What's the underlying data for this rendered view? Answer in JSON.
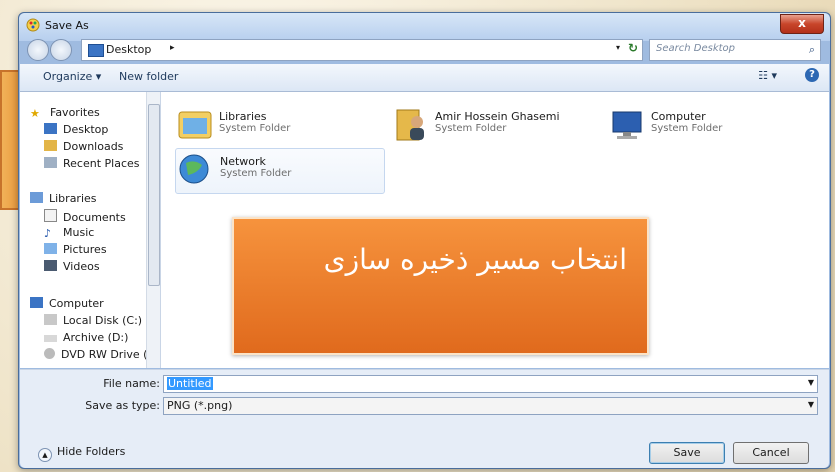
{
  "window": {
    "title": "Save As",
    "close_label": "x"
  },
  "address": {
    "location": "Desktop",
    "separator": "▸",
    "dropdown": "▾",
    "refresh": "↻"
  },
  "search": {
    "placeholder": "Search Desktop"
  },
  "toolbar": {
    "organize": "Organize ▾",
    "new_folder": "New folder",
    "views": "☷ ▾",
    "help": "?"
  },
  "nav": {
    "favorites": [
      "Favorites",
      "Desktop",
      "Downloads",
      "Recent Places"
    ],
    "libraries": [
      "Libraries",
      "Documents",
      "Music",
      "Pictures",
      "Videos"
    ],
    "computer": [
      "Computer",
      "Local Disk (C:)",
      "Archive (D:)",
      "DVD RW Drive (E:"
    ]
  },
  "items": [
    {
      "name": "Libraries",
      "type": "System Folder"
    },
    {
      "name": "Amir Hossein Ghasemi",
      "type": "System Folder"
    },
    {
      "name": "Computer",
      "type": "System Folder"
    },
    {
      "name": "Network",
      "type": "System Folder"
    }
  ],
  "overlay": {
    "text": "انتخاب مسیر ذخیره سازی"
  },
  "form": {
    "file_name_label": "File name:",
    "file_name_value": "Untitled",
    "save_type_label": "Save as type:",
    "save_type_value": "PNG (*.png)"
  },
  "footer": {
    "hide_folders": "Hide Folders",
    "save": "Save",
    "cancel": "Cancel"
  },
  "colors": {
    "banner": "#e06a1d",
    "accent": "#3399ff"
  }
}
